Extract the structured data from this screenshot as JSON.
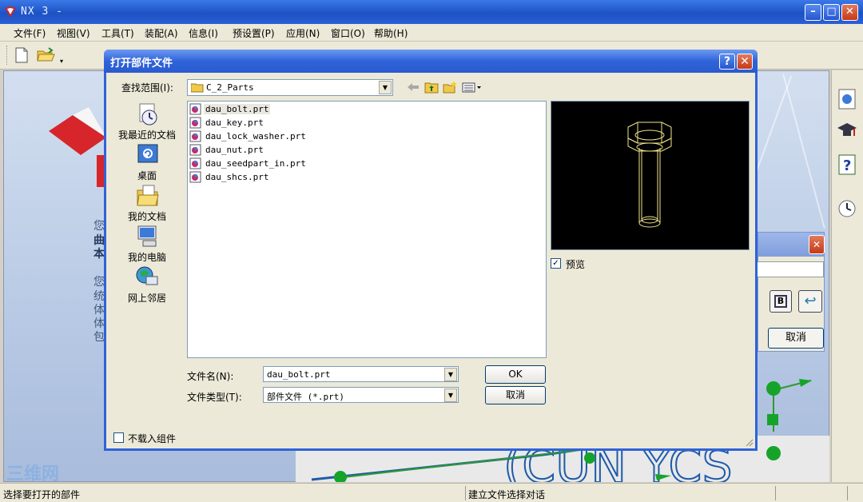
{
  "app": {
    "title": "NX 3 -",
    "menu": [
      {
        "label": "文件(F)"
      },
      {
        "label": "视图(V)"
      },
      {
        "label": "工具(T)"
      },
      {
        "label": "装配(A)"
      },
      {
        "label": "信息(I)"
      },
      {
        "label": "预设置(P)"
      },
      {
        "label": "应用(N)"
      },
      {
        "label": "窗口(O)"
      },
      {
        "label": "帮助(H)"
      }
    ],
    "background_text": [
      "您",
      "曲",
      "本",
      "您",
      "统",
      "体",
      "体",
      "包"
    ],
    "status_left": "选择要打开的部件",
    "status_right": "建立文件选择对话",
    "bg_dialog_cancel": "取消",
    "watermark": "三维网"
  },
  "dialog": {
    "title": "打开部件文件",
    "look_in_label": "查找范围(I):",
    "look_in_value": "C_2_Parts",
    "places": [
      {
        "label": "我最近的文档",
        "icon": "recent-documents-icon"
      },
      {
        "label": "桌面",
        "icon": "desktop-icon"
      },
      {
        "label": "我的文档",
        "icon": "my-documents-icon"
      },
      {
        "label": "我的电脑",
        "icon": "my-computer-icon"
      },
      {
        "label": "网上邻居",
        "icon": "network-places-icon"
      }
    ],
    "files": [
      {
        "name": "dau_bolt.prt",
        "selected": true
      },
      {
        "name": "dau_key.prt",
        "selected": false
      },
      {
        "name": "dau_lock_washer.prt",
        "selected": false
      },
      {
        "name": "dau_nut.prt",
        "selected": false
      },
      {
        "name": "dau_seedpart_in.prt",
        "selected": false
      },
      {
        "name": "dau_shcs.prt",
        "selected": false
      }
    ],
    "preview_checked": true,
    "preview_label": "预览",
    "file_name_label": "文件名(N):",
    "file_name_value": "dau_bolt.prt",
    "file_type_label": "文件类型(T):",
    "file_type_value": "部件文件 (*.prt)",
    "ok_label": "OK",
    "cancel_label": "取消",
    "no_load_components_label": "不载入组件",
    "no_load_components_checked": false
  },
  "colors": {
    "titlebar": "#2f63d8",
    "dialog_bg": "#ece9d8",
    "preview_bg": "#000000",
    "wireframe": "#f2e68a"
  }
}
